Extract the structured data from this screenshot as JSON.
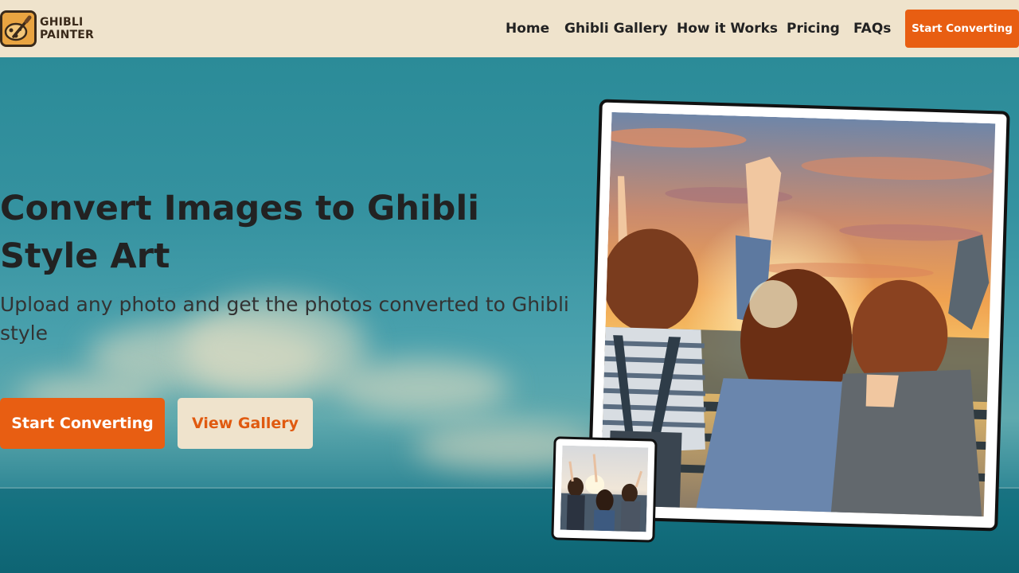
{
  "brand": {
    "line1": "GHIBLI",
    "line2": "PAINTER",
    "logo_icon": "paintbrush-palette-icon",
    "accent_color": "#e85e12",
    "nav_bg": "#efe3cc"
  },
  "nav": {
    "links": [
      {
        "label": "Home"
      },
      {
        "label": "Ghibli Gallery"
      },
      {
        "label": "How it Works"
      },
      {
        "label": "Pricing"
      },
      {
        "label": "FAQs"
      }
    ],
    "cta_label": "Start Converting"
  },
  "hero": {
    "title": "Convert Images to Ghibli Style Art",
    "subtitle": "Upload any photo and get the photos converted to Ghibli style",
    "primary_button": "Start Converting",
    "secondary_button": "View Gallery"
  }
}
